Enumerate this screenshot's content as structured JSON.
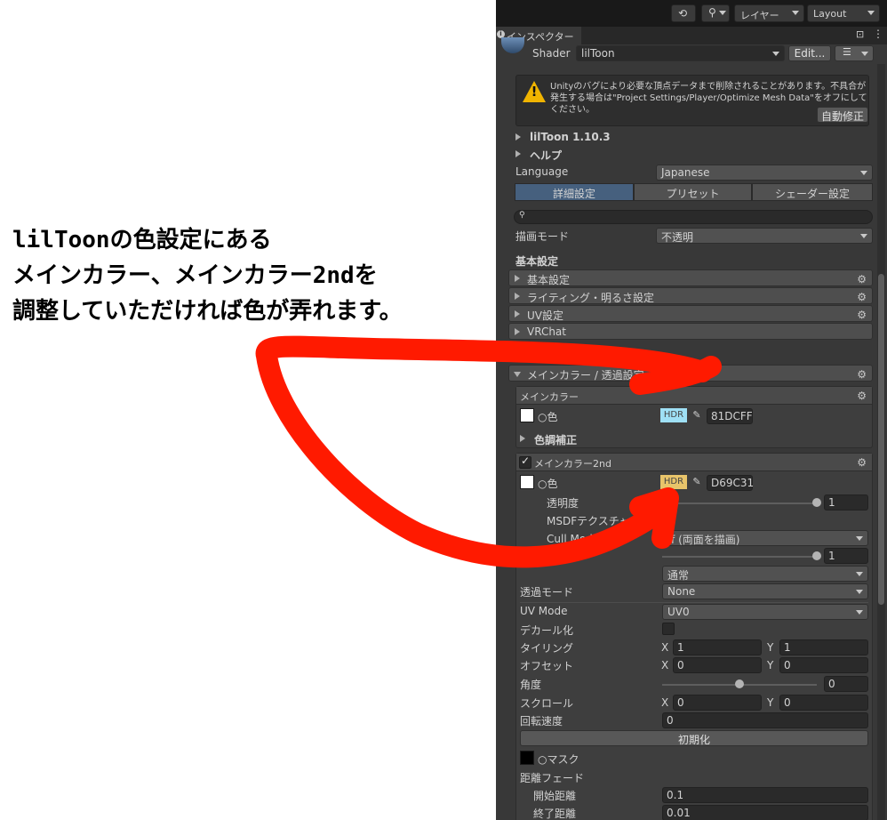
{
  "annotation": {
    "line1": "lilToonの色設定にある",
    "line2": "メインカラー、メインカラー2ndを",
    "line3": "調整していただければ色が弄れます。",
    "arrow_color": "#ff1a00"
  },
  "toolbar": {
    "history_icon": "history-icon",
    "search_icon": "search-icon",
    "layers_label": "レイヤー",
    "layout_label": "Layout"
  },
  "tab": {
    "label": "インスペクター",
    "lock_icon": "lock-icon",
    "menu_icon": "kebab-menu-icon"
  },
  "shader": {
    "label": "Shader",
    "value": "lilToon",
    "edit_label": "Edit...",
    "list_icon": "list-icon"
  },
  "warning": {
    "text": "Unityのバグにより必要な頂点データまで削除されることがあります。不具合が発生する場合は\"Project Settings/Player/Optimize Mesh Data\"をオフにしてください。",
    "button": "自動修正"
  },
  "header": {
    "version": "lilToon 1.10.3",
    "help": "ヘルプ",
    "language_label": "Language",
    "language_value": "Japanese"
  },
  "mode_tabs": [
    {
      "label": "詳細設定",
      "active": true
    },
    {
      "label": "プリセット",
      "active": false
    },
    {
      "label": "シェーダー設定",
      "active": false
    }
  ],
  "render_mode": {
    "label": "描画モード",
    "value": "不透明"
  },
  "basic_settings": "基本設定",
  "sections": [
    {
      "label": "基本設定"
    },
    {
      "label": "ライティング・明るさ設定"
    },
    {
      "label": "UV設定"
    },
    {
      "label": "VRChat"
    }
  ],
  "main_section": {
    "label": "メインカラー / 透過設定"
  },
  "main_color": {
    "title": "メインカラー",
    "color_label": "○色",
    "hdr": "HDR",
    "hex": "81DCFF",
    "hdr_color": "#9fe0f5",
    "correction_label": "色調補正"
  },
  "main_color_2nd": {
    "title": "メインカラー2nd",
    "enabled": true,
    "color_label": "○色",
    "hdr": "HDR",
    "hex": "D69C31",
    "hdr_color": "#e8c46a",
    "opacity_label": "透明度",
    "opacity_value": "1",
    "opacity_level": 1.0,
    "msdf_label": "MSDFテクスチャ",
    "cull_label": "Cull Mode (描",
    "cull_value": "ff (両面を描画)",
    "light_label": "ライトの明",
    "light_value": "1",
    "light_level": 1.0,
    "blend_value": "通常",
    "transparent_label": "透過モード",
    "transparent_value": "None",
    "uvmode_label": "UV Mode",
    "uvmode_value": "UV0",
    "decal_label": "デカール化",
    "tiling_label": "タイリング",
    "tiling_x": "1",
    "tiling_y": "1",
    "offset_label": "オフセット",
    "offset_x": "0",
    "offset_y": "0",
    "angle_label": "角度",
    "angle_value": "0",
    "angle_level": 0.5,
    "scroll_label": "スクロール",
    "scroll_x": "0",
    "scroll_y": "0",
    "rotation_label": "回転速度",
    "rotation_value": "0",
    "reset_label": "初期化",
    "mask_label": "○マスク",
    "distance_fade_label": "距離フェード",
    "fade_start_label": "開始距離",
    "fade_start_value": "0.1",
    "fade_end_label": "終了距離",
    "fade_end_value": "0.01",
    "axis_x": "X",
    "axis_y": "Y"
  }
}
